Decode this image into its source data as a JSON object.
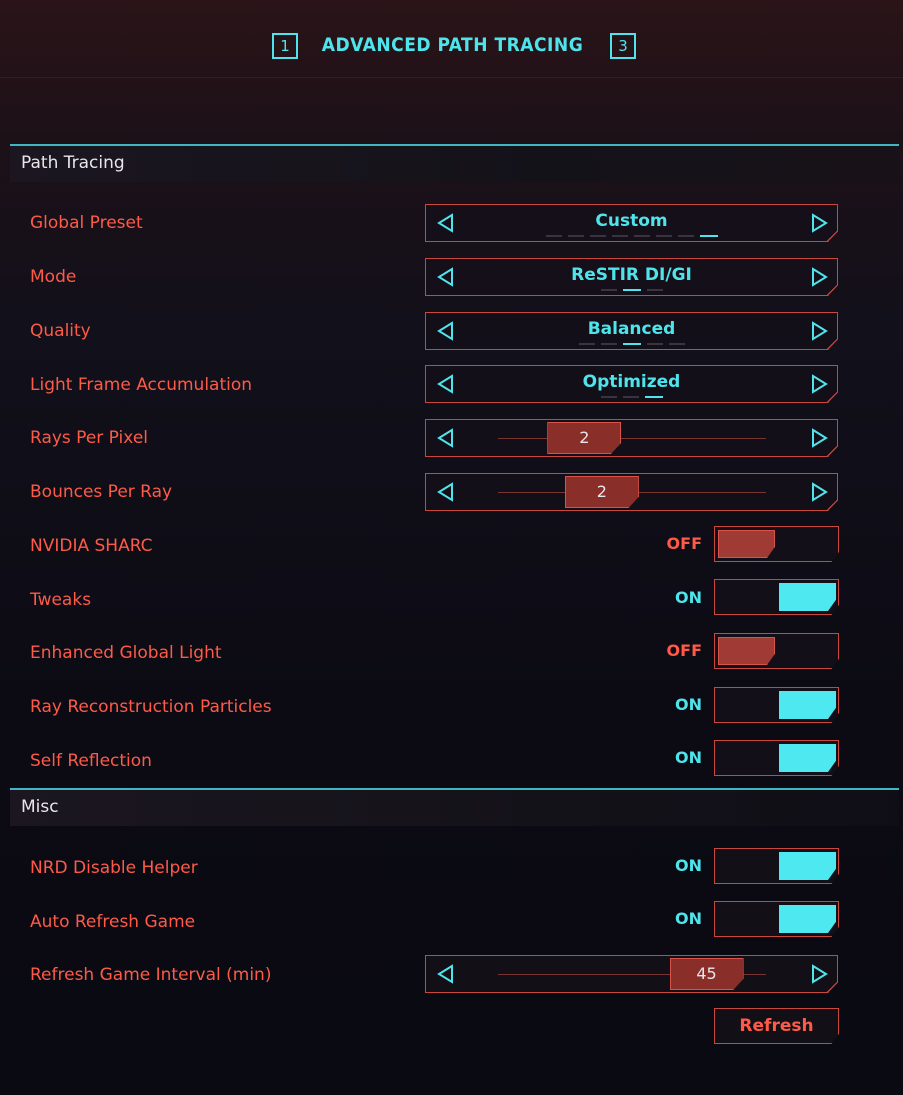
{
  "header": {
    "left_key": "1",
    "title": "ADVANCED PATH TRACING",
    "right_key": "3"
  },
  "sections": {
    "path_tracing": "Path Tracing",
    "misc": "Misc"
  },
  "settings": {
    "global_preset": {
      "label": "Global Preset",
      "value": "Custom",
      "option_count": 8,
      "selected_index": 7
    },
    "mode": {
      "label": "Mode",
      "value": "ReSTIR DI/GI",
      "option_count": 3,
      "selected_index": 1
    },
    "quality": {
      "label": "Quality",
      "value": "Balanced",
      "option_count": 5,
      "selected_index": 2
    },
    "light_frame_accumulation": {
      "label": "Light Frame Accumulation",
      "value": "Optimized",
      "option_count": 3,
      "selected_index": 2
    },
    "rays_per_pixel": {
      "label": "Rays Per Pixel",
      "value": "2",
      "slider_fraction": 0.11
    },
    "bounces_per_ray": {
      "label": "Bounces Per Ray",
      "value": "2",
      "slider_fraction": 0.2
    },
    "nvidia_sharc": {
      "label": "NVIDIA SHARC",
      "state": "OFF"
    },
    "tweaks": {
      "label": "Tweaks",
      "state": "ON"
    },
    "enhanced_global_light": {
      "label": "Enhanced Global Light",
      "state": "OFF"
    },
    "ray_reconstruction_particles": {
      "label": "Ray Reconstruction Particles",
      "state": "ON"
    },
    "self_reflection": {
      "label": "Self Reflection",
      "state": "ON"
    },
    "nrd_disable_helper": {
      "label": "NRD Disable Helper",
      "state": "ON"
    },
    "auto_refresh_game": {
      "label": "Auto Refresh Game",
      "state": "ON"
    },
    "refresh_game_interval": {
      "label": "Refresh Game Interval (min)",
      "value": "45",
      "slider_fraction": 0.74
    }
  },
  "refresh_button": "Refresh",
  "colors": {
    "accent_cyan": "#4fe4ec",
    "accent_red": "#ff5a48",
    "border_red": "#c9473d",
    "section_line": "#3fb6c2"
  }
}
